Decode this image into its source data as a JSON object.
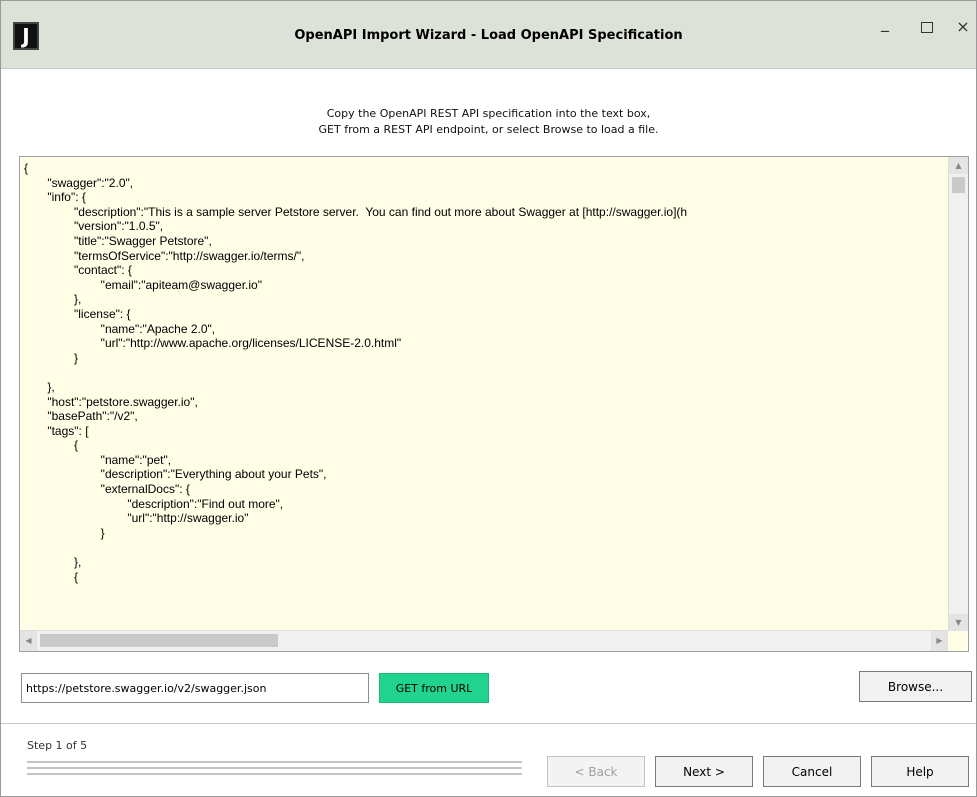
{
  "window": {
    "app_logo_letter": "J",
    "title": "OpenAPI Import Wizard - Load OpenAPI Specification",
    "minimize_glyph": "_",
    "close_glyph": "×"
  },
  "instruction": {
    "line1": "Copy the OpenAPI REST API specification into the text box,",
    "line2": "GET from a REST API endpoint, or select Browse to load a file."
  },
  "editor": {
    "content": "{\n       \"swagger\":\"2.0\",\n       \"info\": {\n               \"description\":\"This is a sample server Petstore server.  You can find out more about Swagger at [http://swagger.io](h\n               \"version\":\"1.0.5\",\n               \"title\":\"Swagger Petstore\",\n               \"termsOfService\":\"http://swagger.io/terms/\",\n               \"contact\": {\n                       \"email\":\"apiteam@swagger.io\"\n               },\n               \"license\": {\n                       \"name\":\"Apache 2.0\",\n                       \"url\":\"http://www.apache.org/licenses/LICENSE-2.0.html\"\n               }\n\n       },\n       \"host\":\"petstore.swagger.io\",\n       \"basePath\":\"/v2\",\n       \"tags\": [\n               {\n                       \"name\":\"pet\",\n                       \"description\":\"Everything about your Pets\",\n                       \"externalDocs\": {\n                               \"description\":\"Find out more\",\n                               \"url\":\"http://swagger.io\"\n                       }\n\n               },\n               {"
  },
  "url_row": {
    "url_value": "https://petstore.swagger.io/v2/swagger.json",
    "get_button_label": "GET from URL",
    "get_button_color": "#20d48f",
    "browse_button_label": "Browse..."
  },
  "footer": {
    "step_label": "Step 1 of 5",
    "progress_fraction": 0,
    "back_label": "< Back",
    "next_label": "Next >",
    "cancel_label": "Cancel",
    "help_label": "Help"
  }
}
